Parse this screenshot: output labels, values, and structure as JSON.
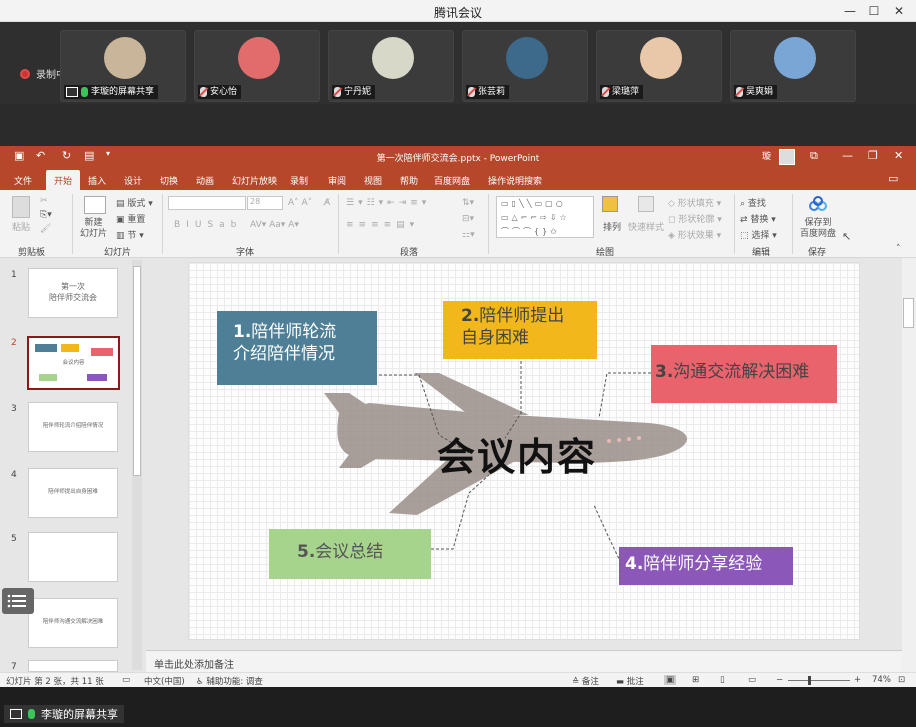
{
  "app": {
    "title": "腾讯会议",
    "window_buttons": [
      "—",
      "☐",
      "✕"
    ]
  },
  "meeting": {
    "recording_label": "录制中",
    "participants": [
      {
        "name": "李璇的屏幕共享",
        "mic": "on",
        "av": "#c8b59a"
      },
      {
        "name": "安心怡",
        "mic": "off",
        "av": "#e26b6b"
      },
      {
        "name": "宁丹妮",
        "mic": "off",
        "av": "#d8d8c8"
      },
      {
        "name": "张芸莉",
        "mic": "off",
        "av": "#3d6a8a"
      },
      {
        "name": "梁璐萍",
        "mic": "off",
        "av": "#e8c8a8"
      },
      {
        "name": "吴爽娟",
        "mic": "off",
        "av": "#7aa6d6"
      }
    ],
    "share_label": "李璇的屏幕共享"
  },
  "ppt": {
    "title": "第一次陪伴师交流会.pptx  -  PowerPoint",
    "user_initial": "璇",
    "tabs": [
      "文件",
      "开始",
      "插入",
      "设计",
      "切换",
      "动画",
      "幻灯片放映",
      "录制",
      "审阅",
      "视图",
      "帮助",
      "百度网盘",
      "操作说明搜索"
    ],
    "active_tab": "开始",
    "ribbon": {
      "groups": [
        "剪贴板",
        "幻灯片",
        "字体",
        "段落",
        "绘图",
        "编辑",
        "保存"
      ],
      "paste": "粘贴",
      "new_slide": "新建\n幻灯片",
      "layout": "版式",
      "reset": "重置",
      "section": "节",
      "font_size": "28",
      "arrange": "排列",
      "quick_styles": "快速样式",
      "shape_fill": "形状填充",
      "shape_outline": "形状轮廓",
      "shape_effects": "形状效果",
      "find": "查找",
      "replace": "替换",
      "select": "选择",
      "save_to": "保存到\n百度网盘"
    },
    "thumbnails": [
      {
        "num": "1",
        "title": "第一次\n陪伴师交流会"
      },
      {
        "num": "2",
        "title": "会议内容",
        "selected": true
      },
      {
        "num": "3",
        "title": "陪伴师轮流介绍陪伴情况"
      },
      {
        "num": "4",
        "title": "陪伴师提出自身困难"
      },
      {
        "num": "5",
        "title": ""
      },
      {
        "num": "6",
        "title": "陪伴师沟通交流解决困难"
      },
      {
        "num": "7",
        "title": ""
      }
    ],
    "slide": {
      "center_title": "会议内容",
      "items": [
        {
          "num": "1.",
          "text": "陪伴师轮流\n介绍陪伴情况",
          "color": "#4e7f96"
        },
        {
          "num": "2.",
          "text": "陪伴师提出\n自身困难",
          "color": "#f2b81b"
        },
        {
          "num": "3.",
          "text": "沟通交流解决困难",
          "color": "#e8636b"
        },
        {
          "num": "4.",
          "text": "陪伴师分享经验",
          "color": "#8b57b8"
        },
        {
          "num": "5.",
          "text": "会议总结",
          "color": "#a7d48c"
        }
      ]
    },
    "notes_placeholder": "单击此处添加备注",
    "status": {
      "slide_info": "幻灯片 第 2 张，共 11 张",
      "language": "中文(中国)",
      "accessibility": "辅助功能: 调查",
      "notes": "备注",
      "comments": "批注",
      "zoom": "74%"
    }
  }
}
